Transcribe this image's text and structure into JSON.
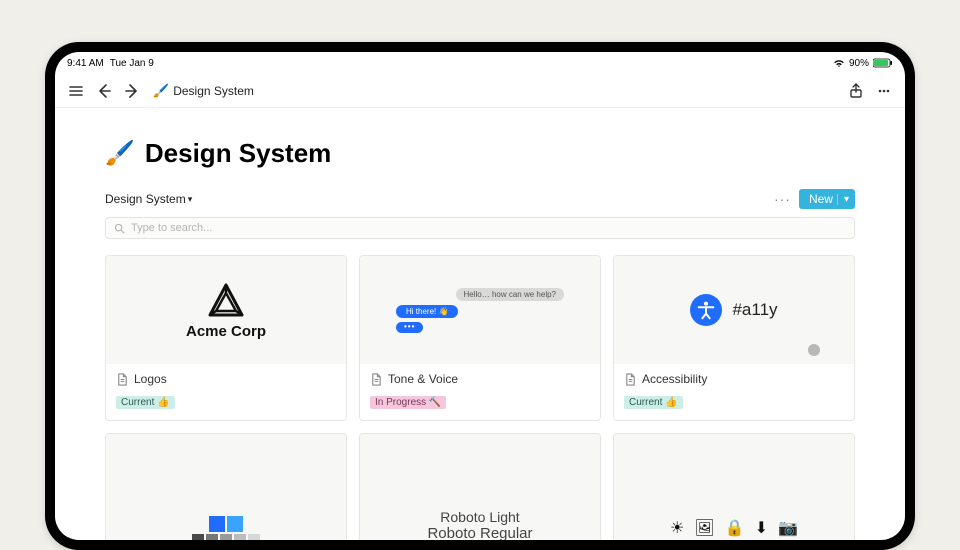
{
  "status": {
    "time": "9:41 AM",
    "date": "Tue Jan 9",
    "battery": "90%"
  },
  "toolbar": {
    "breadcrumb_title": "Design System"
  },
  "page": {
    "icon": "🖌️",
    "title": "Design System"
  },
  "view": {
    "name": "Design System",
    "new_label": "New"
  },
  "search": {
    "placeholder": "Type to search..."
  },
  "tags": {
    "current": "Current 👍",
    "in_progress": "In Progress 🔨"
  },
  "cards": [
    {
      "title": "Logos",
      "tag": "current",
      "cover": {
        "brand": "Acme Corp"
      }
    },
    {
      "title": "Tone & Voice",
      "tag": "in_progress",
      "cover": {
        "msg1": "Hello… how can we help?",
        "msg2": "Hi there! 👋"
      }
    },
    {
      "title": "Accessibility",
      "tag": "current",
      "cover": {
        "label": "#a11y"
      }
    }
  ],
  "row2": {
    "palette": {
      "primary1": "#1f6cff",
      "primary2": "#3aa3ff",
      "greys": [
        "#4a4a4a",
        "#777",
        "#9a9a9a",
        "#bdbdbd",
        "#d8d8d8"
      ]
    },
    "fonts": {
      "light": "Roboto Light",
      "regular": "Roboto Regular"
    }
  }
}
